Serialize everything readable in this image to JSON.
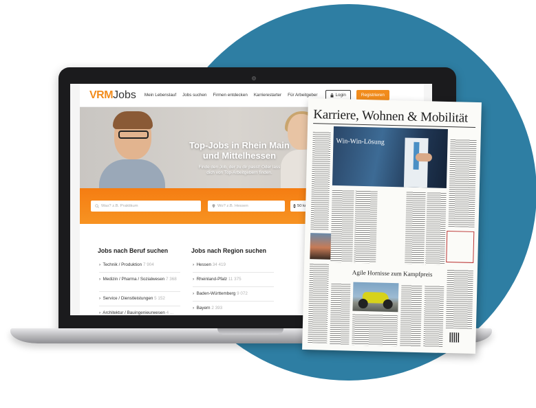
{
  "site": {
    "logo_vrm": "VRM",
    "logo_jobs": "Jobs",
    "nav": [
      "Mein Lebenslauf",
      "Jobs suchen",
      "Firmen entdecken",
      "Karrierestarter",
      "Für Arbeitgeber"
    ],
    "login_label": "Login",
    "register_label": "Registrieren"
  },
  "hero": {
    "title_line1": "Top-Jobs in Rhein Main",
    "title_line2": "und Mittelhessen",
    "subtitle_line1": "Finde den Job, der zu dir passt! Oder lass",
    "subtitle_line2": "dich von Top-Arbeitgebern finden."
  },
  "search": {
    "keyword_placeholder": "Was? z.B. Praktikum",
    "location_placeholder": "Wo? z.B. Hessen",
    "radius_value": "50 km"
  },
  "by_profession": {
    "heading": "Jobs nach Beruf suchen",
    "items": [
      {
        "label": "Technik / Produktion",
        "count": "7 904"
      },
      {
        "label": "Medizin / Pharma / Sozialwesen",
        "count": "7 368"
      },
      {
        "label": "Service / Dienstleistungen",
        "count": "5 152"
      },
      {
        "label": "Architektur / Bauingenieurwesen",
        "count": "4 ..."
      }
    ]
  },
  "by_region": {
    "heading": "Jobs nach Region suchen",
    "items": [
      {
        "label": "Hessen",
        "count": "34 419"
      },
      {
        "label": "Rheinland-Pfalz",
        "count": "11 375"
      },
      {
        "label": "Baden-Württemberg",
        "count": "9 072"
      },
      {
        "label": "Bayern",
        "count": "2 393"
      }
    ]
  },
  "newspaper": {
    "title": "Karriere, Wohnen & Mobilität",
    "headline_main": "Win-Win-Lösung",
    "headline_second": "Agile Hornisse zum Kampfpreis"
  },
  "colors": {
    "accent_orange": "#f28c1c",
    "circle_blue": "#2e7ea3"
  }
}
